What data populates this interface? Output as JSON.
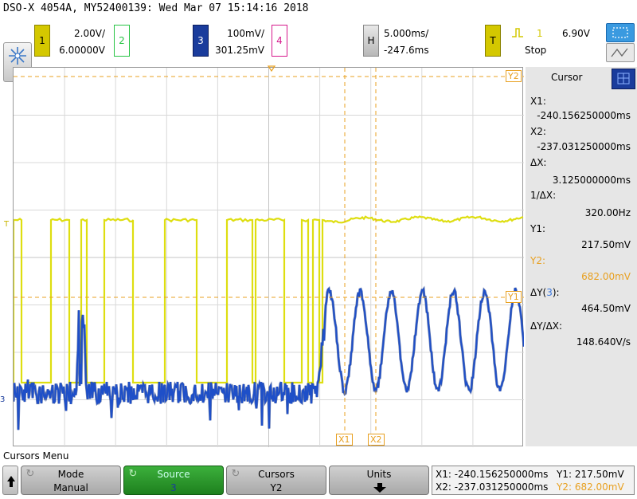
{
  "title": "DSO-X 4054A, MY52400139: Wed Mar 07 15:14:16 2018",
  "channels": {
    "ch1": {
      "num": "1",
      "scale": "2.00V/",
      "offset": "6.00000V",
      "color": "#d4c800"
    },
    "ch2": {
      "num": "2",
      "color": "#27c444"
    },
    "ch3": {
      "num": "3",
      "scale": "100mV/",
      "offset": "301.25mV",
      "color": "#1a3c9c"
    },
    "ch4": {
      "num": "4",
      "color": "#d6198c"
    }
  },
  "horizontal": {
    "label": "H",
    "scale": "5.000ms/",
    "position": "-247.6ms"
  },
  "trigger": {
    "label": "T",
    "source": "1",
    "level": "6.90V",
    "status": "Stop"
  },
  "markers": {
    "y2": "Y2",
    "y1": "Y1",
    "x1": "X1",
    "x2": "X2",
    "t": "T",
    "ch3": "3"
  },
  "cursor_panel": {
    "title": "Cursor",
    "x1_label": "X1:",
    "x1_value": "-240.156250000ms",
    "x2_label": "X2:",
    "x2_value": "-237.031250000ms",
    "dx_label": "ΔX:",
    "dx_value": "3.125000000ms",
    "inv_dx_label": "1/ΔX:",
    "inv_dx_value": "320.00Hz",
    "y1_label": "Y1:",
    "y1_value": "217.50mV",
    "y2_label": "Y2:",
    "y2_value": "682.00mV",
    "dy_label_pre": "ΔY(",
    "dy_label_ch": "3",
    "dy_label_post": "):",
    "dy_value": "464.50mV",
    "dydx_label": "ΔY/ΔX:",
    "dydx_value": "148.640V/s"
  },
  "menu": {
    "title": "Cursors Menu",
    "mode_label": "Mode",
    "mode_value": "Manual",
    "source_label": "Source",
    "source_value": "3",
    "cursors_label": "Cursors",
    "cursors_value": "Y2",
    "units_label": "Units"
  },
  "readout": {
    "x1": "X1: -240.156250000ms",
    "x2": "X2: -237.031250000ms",
    "y1": "Y1: 217.50mV",
    "y2": "Y2: 682.00mV"
  },
  "colors": {
    "cursor_orange": "#e8a020",
    "softkey_green": "#2e9e2e",
    "ch3_trace": "#1e4fc8",
    "ch1_trace": "#dede10"
  }
}
